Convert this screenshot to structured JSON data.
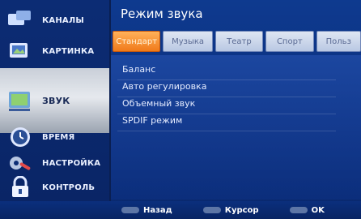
{
  "sidebar": {
    "items": [
      {
        "label": "КАНАЛЫ",
        "icon": "channels-icon"
      },
      {
        "label": "КАРТИНКА",
        "icon": "picture-icon"
      },
      {
        "label": "ЗВУК",
        "icon": "sound-icon"
      },
      {
        "label": "ВРЕМЯ",
        "icon": "clock-icon"
      },
      {
        "label": "НАСТРОЙКА",
        "icon": "settings-icon"
      },
      {
        "label": "КОНТРОЛЬ",
        "icon": "lock-icon"
      }
    ],
    "active": "ЗВУК"
  },
  "main": {
    "title": "Режим звука",
    "tabs": [
      "Стандарт",
      "Музыка",
      "Театр",
      "Спорт",
      "Польз"
    ],
    "active_tab": "Стандарт",
    "menu": [
      "Баланс",
      "Авто регулировка",
      "Объемный звук",
      "SPDIF режим"
    ]
  },
  "footer": {
    "back": "Назад",
    "cursor": "Курсор",
    "ok": "OK"
  },
  "colors": {
    "accent": "#f07a1a",
    "background": "#0e3a8f"
  }
}
